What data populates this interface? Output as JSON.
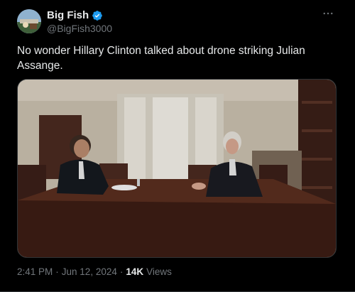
{
  "author": {
    "display_name": "Big Fish",
    "handle": "@BigFish3000",
    "verified": true
  },
  "tweet": {
    "text": "No wonder Hillary Clinton talked about drone striking Julian Assange."
  },
  "meta": {
    "time": "2:41 PM",
    "separator1": "·",
    "date": "Jun 12, 2024",
    "separator2": "·",
    "views_count": "14K",
    "views_label": "Views"
  },
  "colors": {
    "background": "#000000",
    "text": "#e7e9ea",
    "muted": "#71767b",
    "verified": "#1d9bf0"
  },
  "icons": {
    "verified": "verified-badge-icon",
    "more": "more-horizontal-icon"
  }
}
